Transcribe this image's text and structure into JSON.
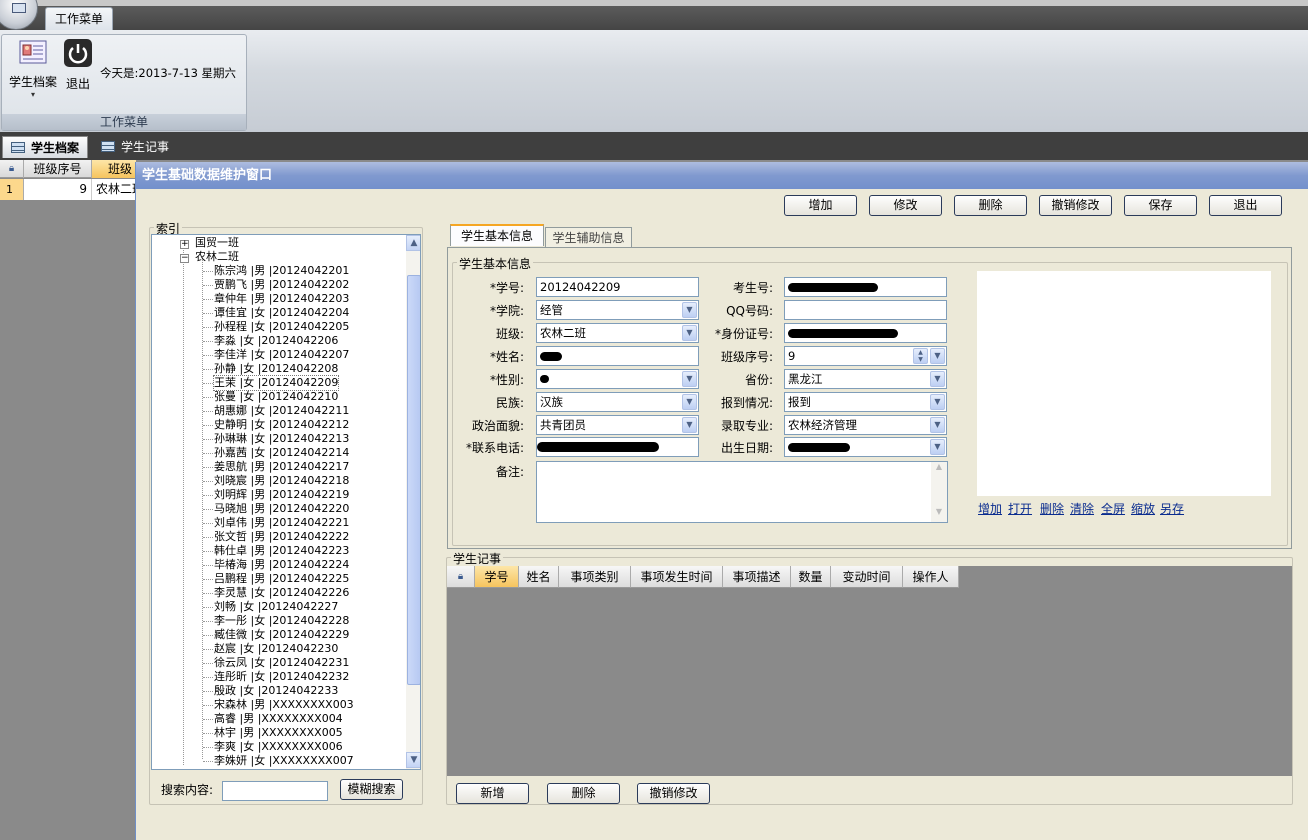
{
  "ribbon": {
    "tab": "工作菜单",
    "buttons": [
      {
        "label": "学生档案",
        "icon": "student-card-icon"
      },
      {
        "label": "退出",
        "icon": "power-icon"
      }
    ],
    "date_text": "今天是:2013-7-13  星期六",
    "group_caption": "工作菜单"
  },
  "doc_tabs": [
    "学生档案",
    "学生记事"
  ],
  "bg_grid": {
    "columns": [
      "班级序号",
      "班级"
    ],
    "rows": [
      {
        "num": "1",
        "c1": "9",
        "c2": "农林二班"
      }
    ]
  },
  "window": {
    "title": "学生基础数据维护窗口",
    "toolbar": [
      "增加",
      "修改",
      "删除",
      "撤销修改",
      "保存",
      "退出"
    ],
    "index_title": "索引",
    "tree": {
      "collapsed": "国贸一班",
      "expanded": "农林二班",
      "students": [
        "陈宗鸿 |男 |20124042201",
        "贾鹏飞 |男 |20124042202",
        "章仲年 |男 |20124042203",
        "谭佳宜 |女 |20124042204",
        "孙程程 |女 |20124042205",
        "李淼 |女 |20124042206",
        "李佳洋 |女 |20124042207",
        "孙静 |女 |20124042208",
        "王茉 |女 |20124042209",
        "张曼 |女 |20124042210",
        "胡惠娜 |女 |20124042211",
        "史静明 |女 |20124042212",
        "孙琳琳 |女 |20124042213",
        "孙嘉茜 |女 |20124042214",
        "姜思航 |男 |20124042217",
        "刘晓宸 |男 |20124042218",
        "刘明辉 |男 |20124042219",
        "马晓旭 |男 |20124042220",
        "刘卓伟 |男 |20124042221",
        "张文哲 |男 |20124042222",
        "韩仕卓 |男 |20124042223",
        "毕椿海 |男 |20124042224",
        "吕鹏程 |男 |20124042225",
        "李灵慧 |女 |20124042226",
        "刘畅 |女 |20124042227",
        "李一彤 |女 |20124042228",
        "臧佳微 |女 |20124042229",
        "赵宸 |女 |20124042230",
        "徐云凤 |女 |20124042231",
        "连彤昕 |女 |20124042232",
        "殷政 |女 |20124042233",
        "宋森林 |男 |XXXXXXXX003",
        "高睿 |男 |XXXXXXXX004",
        "林宇 |男 |XXXXXXXX005",
        "李爽 |女 |XXXXXXXX006",
        "李姝妍 |女 |XXXXXXXX007"
      ],
      "selected_index": 8
    },
    "search": {
      "label": "搜索内容:",
      "button": "模糊搜索",
      "value": ""
    },
    "tabs": [
      "学生基本信息",
      "学生辅助信息"
    ],
    "basic_title": "学生基本信息",
    "fields": {
      "student_id": {
        "label": "*学号:",
        "value": "20124042209"
      },
      "college": {
        "label": "*学院:",
        "value": "经管"
      },
      "class": {
        "label": "班级:",
        "value": "农林二班"
      },
      "name": {
        "label": "*姓名:",
        "value": ""
      },
      "gender": {
        "label": "*性别:",
        "value": ""
      },
      "ethnicity": {
        "label": "民族:",
        "value": "汉族"
      },
      "politics": {
        "label": "政治面貌:",
        "value": "共青团员"
      },
      "phone": {
        "label": "*联系电话:",
        "value": ""
      },
      "remark": {
        "label": "备注:",
        "value": ""
      },
      "exam_no": {
        "label": "考生号:",
        "value": ""
      },
      "qq": {
        "label": "QQ号码:",
        "value": ""
      },
      "idcard": {
        "label": "*身份证号:",
        "value": ""
      },
      "seq": {
        "label": "班级序号:",
        "value": "9"
      },
      "province": {
        "label": "省份:",
        "value": "黑龙江"
      },
      "report": {
        "label": "报到情况:",
        "value": "报到"
      },
      "major": {
        "label": "录取专业:",
        "value": "农林经济管理"
      },
      "birth": {
        "label": "出生日期:",
        "value": ""
      }
    },
    "photo_links": [
      "增加",
      "打开",
      "删除",
      "清除",
      "全屏",
      "缩放",
      "另存"
    ],
    "journal": {
      "title": "学生记事",
      "columns": [
        "学号",
        "姓名",
        "事项类别",
        "事项发生时间",
        "事项描述",
        "数量",
        "变动时间",
        "操作人"
      ],
      "buttons": [
        "新增",
        "删除",
        "撤销修改"
      ]
    }
  },
  "colors": {
    "title_bar": "#7390cc",
    "window_bg": "#ece9d8",
    "sort_header": "#f6c45e"
  }
}
